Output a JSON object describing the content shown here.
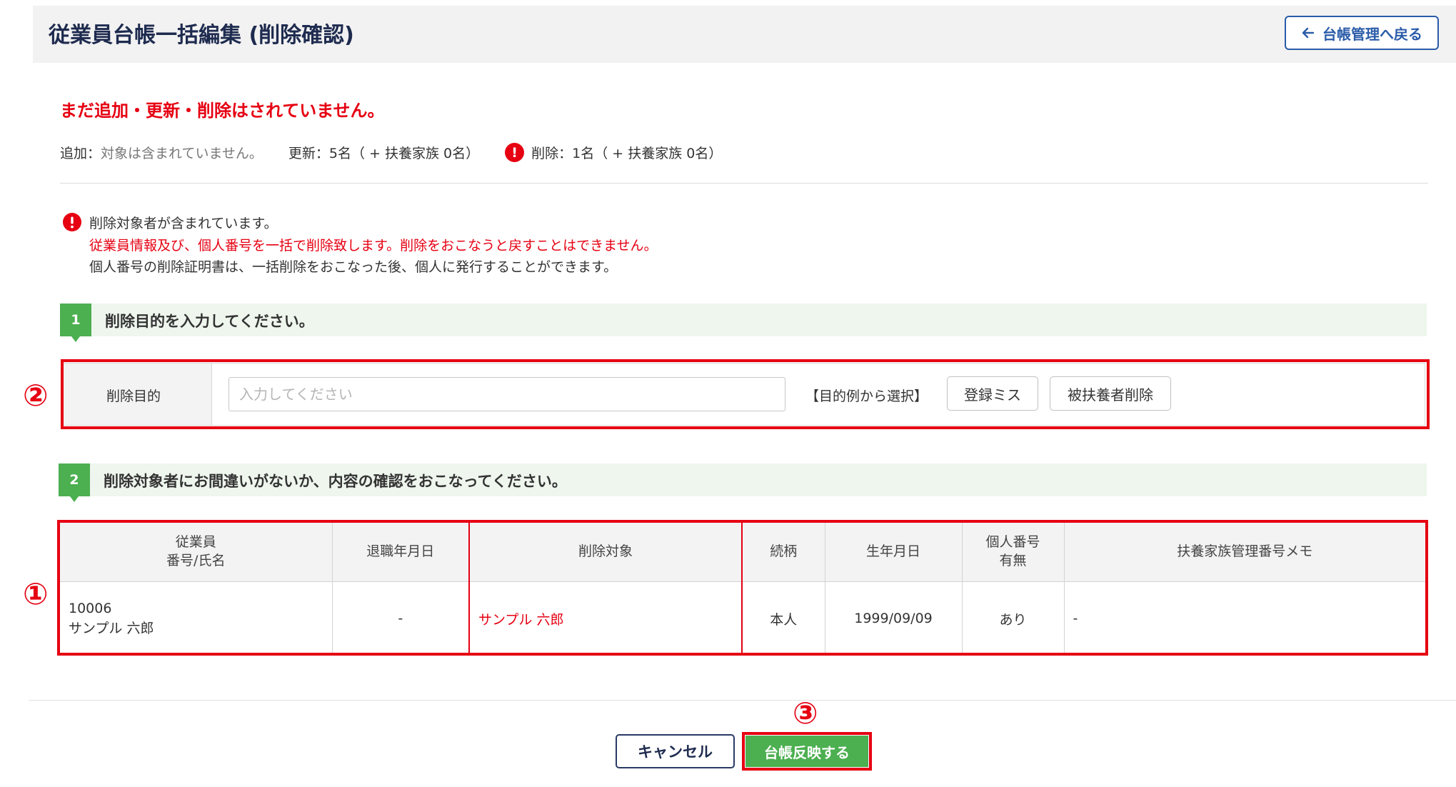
{
  "header": {
    "title": "従業員台帳一括編集 (削除確認)",
    "back_button_label": "台帳管理へ戻る"
  },
  "notice": "まだ追加・更新・削除はされていません。",
  "summary": {
    "add_label": "追加：",
    "add_value": "対象は含まれていません。",
    "update_text": "更新：5名（ + 扶養家族 0名）",
    "delete_text": "削除：1名（ + 扶養家族 0名）"
  },
  "warning": {
    "line1": "削除対象者が含まれています。",
    "line2": "従業員情報及び、個人番号を一括で削除致します。削除をおこなうと戻すことはできません。",
    "line3": "個人番号の削除証明書は、一括削除をおこなった後、個人に発行することができます。"
  },
  "step1": {
    "number": "1",
    "text": "削除目的を入力してください。",
    "field_label": "削除目的",
    "input_placeholder": "入力してください",
    "input_value": "",
    "examples_label": "【目的例から選択】",
    "example_buttons": [
      "登録ミス",
      "被扶養者削除"
    ]
  },
  "step2": {
    "number": "2",
    "text": "削除対象者にお間違いがないか、内容の確認をおこなってください。",
    "table": {
      "headers": [
        [
          "従業員",
          "番号/氏名"
        ],
        [
          "退職年月日"
        ],
        [
          "削除対象"
        ],
        [
          "続柄"
        ],
        [
          "生年月日"
        ],
        [
          "個人番号",
          "有無"
        ],
        [
          "扶養家族管理番号メモ"
        ]
      ],
      "rows": [
        {
          "employee_no": "10006",
          "employee_name": "サンプル 六郎",
          "retirement_date": "-",
          "delete_target": "サンプル 六郎",
          "relation": "本人",
          "birth_date": "1999/09/09",
          "my_number": "あり",
          "memo": "-"
        }
      ]
    }
  },
  "buttons": {
    "cancel": "キャンセル",
    "apply": "台帳反映する"
  },
  "markers": {
    "one": "①",
    "two": "②",
    "three": "③"
  },
  "colors": {
    "danger": "#e60012",
    "primary_navy": "#1e2b4f",
    "accent_blue": "#2a5ba8",
    "success_green": "#4caf50",
    "step_bar_bg": "#eef6ee"
  },
  "icons": {
    "back": "arrow-left-icon",
    "alert": "exclamation-circle-icon"
  }
}
